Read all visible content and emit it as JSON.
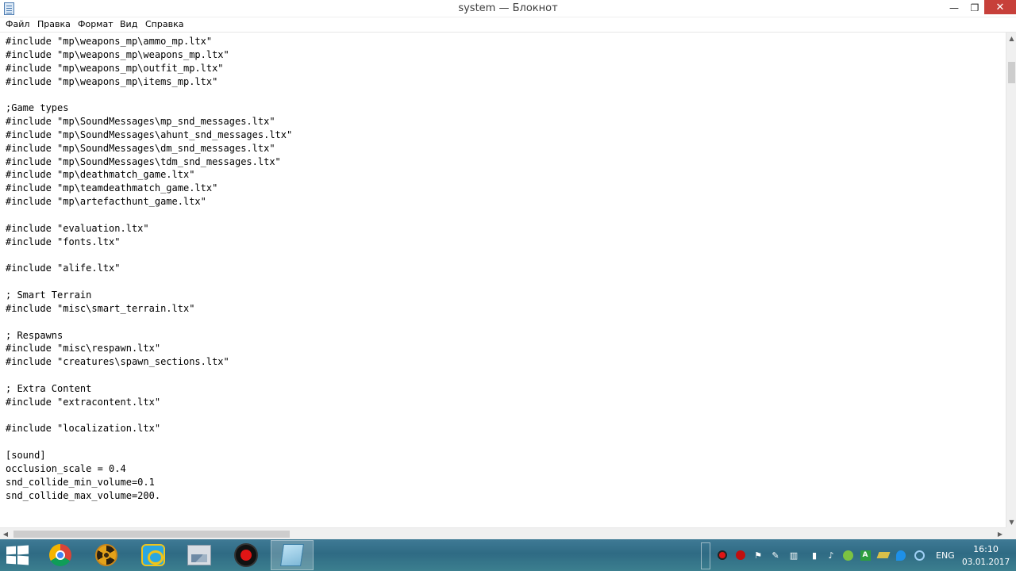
{
  "window": {
    "title": "system — Блокнот",
    "minimize_glyph": "—",
    "maximize_glyph": "❐",
    "close_glyph": "✕"
  },
  "menu": {
    "items": [
      "Файл",
      "Правка",
      "Формат",
      "Вид",
      "Справка"
    ]
  },
  "editor": {
    "lines": [
      "#include \"mp\\weapons_mp\\ammo_mp.ltx\"",
      "#include \"mp\\weapons_mp\\weapons_mp.ltx\"",
      "#include \"mp\\weapons_mp\\outfit_mp.ltx\"",
      "#include \"mp\\weapons_mp\\items_mp.ltx\"",
      "",
      ";Game types",
      "#include \"mp\\SoundMessages\\mp_snd_messages.ltx\"",
      "#include \"mp\\SoundMessages\\ahunt_snd_messages.ltx\"",
      "#include \"mp\\SoundMessages\\dm_snd_messages.ltx\"",
      "#include \"mp\\SoundMessages\\tdm_snd_messages.ltx\"",
      "#include \"mp\\deathmatch_game.ltx\"",
      "#include \"mp\\teamdeathmatch_game.ltx\"",
      "#include \"mp\\artefacthunt_game.ltx\"",
      "",
      "#include \"evaluation.ltx\"",
      "#include \"fonts.ltx\"",
      "",
      "#include \"alife.ltx\"",
      "",
      "; Smart Terrain",
      "#include \"misc\\smart_terrain.ltx\"",
      "",
      "; Respawns",
      "#include \"misc\\respawn.ltx\"",
      "#include \"creatures\\spawn_sections.ltx\"",
      "",
      "; Extra Content",
      "#include \"extracontent.ltx\"",
      "",
      "#include \"localization.ltx\"",
      "",
      "[sound]",
      "occlusion_scale = 0.4",
      "snd_collide_min_volume=0.1",
      "snd_collide_max_volume=200."
    ]
  },
  "scrollbars": {
    "up": "▲",
    "down": "▼",
    "left": "◀",
    "right": "▶"
  },
  "taskbar": {
    "apps": [
      {
        "name": "chrome-icon",
        "active": false
      },
      {
        "name": "radiation-icon",
        "active": false
      },
      {
        "name": "folder-icon",
        "active": false
      },
      {
        "name": "photos-icon",
        "active": false
      },
      {
        "name": "record-icon",
        "active": false
      },
      {
        "name": "notepad-icon",
        "active": true
      }
    ],
    "language": "ENG",
    "time": "16:10",
    "date": "03.01.2017"
  },
  "colors": {
    "taskbar": "#2f6b84",
    "close_button": "#c7403a"
  }
}
